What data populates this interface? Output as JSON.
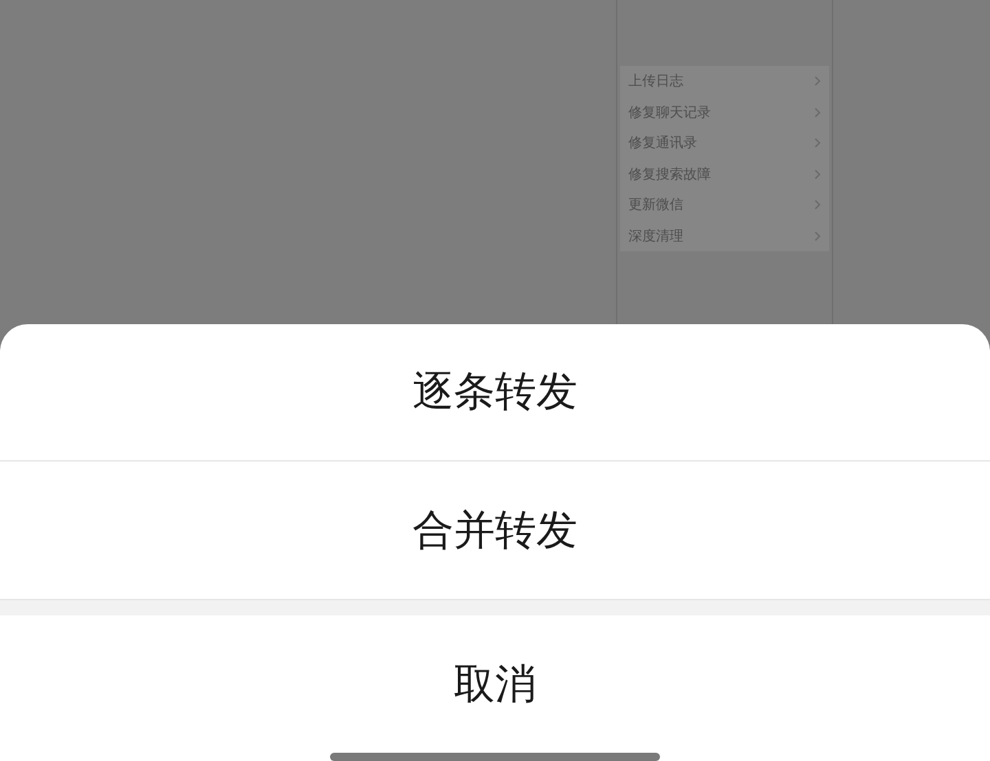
{
  "background_screen": {
    "items": [
      {
        "label": "上传日志"
      },
      {
        "label": "修复聊天记录"
      },
      {
        "label": "修复通讯录"
      },
      {
        "label": "修复搜索故障"
      },
      {
        "label": "更新微信"
      },
      {
        "label": "深度清理"
      }
    ]
  },
  "action_sheet": {
    "actions": [
      {
        "label": "逐条转发"
      },
      {
        "label": "合并转发"
      }
    ],
    "cancel": "取消"
  }
}
